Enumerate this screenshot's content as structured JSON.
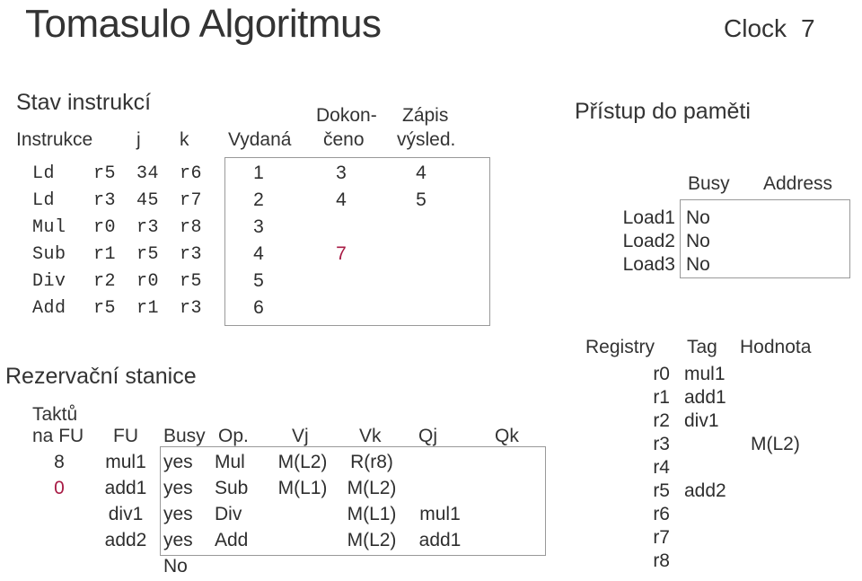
{
  "slide": {
    "title": "Tomasulo Algoritmus",
    "clock_label": "Clock",
    "clock_value": "7",
    "accent_color": "#a81b45",
    "text_color": "#2e2e2e"
  },
  "instruction_status": {
    "heading": "Stav instrukcí",
    "columns": {
      "instruction": "Instrukce",
      "j": "j",
      "k": "k",
      "issued": "Vydaná",
      "completed_line1": "Dokon-",
      "completed_line2": "čeno",
      "write_line1": "Zápis",
      "write_line2": "výsled."
    },
    "rows": [
      {
        "op": "Ld",
        "j": "r5",
        "k": "34",
        "dest": "r6",
        "issued": "1",
        "completed": "3",
        "write": "4",
        "completed_accent": false
      },
      {
        "op": "Ld",
        "j": "r3",
        "k": "45",
        "dest": "r7",
        "issued": "2",
        "completed": "4",
        "write": "5",
        "completed_accent": false
      },
      {
        "op": "Mul",
        "j": "r0",
        "k": "r3",
        "dest": "r8",
        "issued": "3",
        "completed": "",
        "write": "",
        "completed_accent": false
      },
      {
        "op": "Sub",
        "j": "r1",
        "k": "r5",
        "dest": "r3",
        "issued": "4",
        "completed": "7",
        "write": "",
        "completed_accent": true
      },
      {
        "op": "Div",
        "j": "r2",
        "k": "r0",
        "dest": "r5",
        "issued": "5",
        "completed": "",
        "write": "",
        "completed_accent": false
      },
      {
        "op": "Add",
        "j": "r5",
        "k": "r1",
        "dest": "r3",
        "issued": "6",
        "completed": "",
        "write": "",
        "completed_accent": false
      }
    ]
  },
  "reservation_stations": {
    "heading": "Rezervační stanice",
    "columns": {
      "cycles_line1": "Taktů",
      "cycles_line2": "na FU",
      "fu": "FU",
      "busy": "Busy",
      "op": "Op.",
      "vj": "Vj",
      "vk": "Vk",
      "qj": "Qj",
      "qk": "Qk"
    },
    "rows": [
      {
        "cycles": "8",
        "cycles_accent": false,
        "fu": "mul1",
        "busy": "yes",
        "op": "Mul",
        "vj": "M(L2)",
        "vk": "R(r8)",
        "qj": "",
        "qk": ""
      },
      {
        "cycles": "0",
        "cycles_accent": true,
        "fu": "add1",
        "busy": "yes",
        "op": "Sub",
        "vj": "M(L1)",
        "vk": "M(L2)",
        "qj": "",
        "qk": ""
      },
      {
        "cycles": "",
        "cycles_accent": false,
        "fu": "div1",
        "busy": "yes",
        "op": "Div",
        "vj": "",
        "vk": "M(L1)",
        "qj": "mul1",
        "qk": ""
      },
      {
        "cycles": "",
        "cycles_accent": false,
        "fu": "add2",
        "busy": "yes",
        "op": "Add",
        "vj": "",
        "vk": "M(L2)",
        "qj": "add1",
        "qk": ""
      },
      {
        "cycles": "",
        "cycles_accent": false,
        "fu": "",
        "busy": "No",
        "op": "",
        "vj": "",
        "vk": "",
        "qj": "",
        "qk": ""
      }
    ]
  },
  "memory_access": {
    "heading": "Přístup do paměti",
    "columns": {
      "busy": "Busy",
      "address": "Address"
    },
    "rows": [
      {
        "name": "Load1",
        "busy": "No",
        "address": ""
      },
      {
        "name": "Load2",
        "busy": "No",
        "address": ""
      },
      {
        "name": "Load3",
        "busy": "No",
        "address": ""
      }
    ]
  },
  "registers": {
    "columns": {
      "register": "Registry",
      "tag": "Tag",
      "value": "Hodnota"
    },
    "rows": [
      {
        "reg": "r0",
        "tag": "mul1",
        "value": ""
      },
      {
        "reg": "r1",
        "tag": "add1",
        "value": ""
      },
      {
        "reg": "r2",
        "tag": "div1",
        "value": ""
      },
      {
        "reg": "r3",
        "tag": "",
        "value": "M(L2)"
      },
      {
        "reg": "r4",
        "tag": "",
        "value": ""
      },
      {
        "reg": "r5",
        "tag": "add2",
        "value": ""
      },
      {
        "reg": "r6",
        "tag": "",
        "value": ""
      },
      {
        "reg": "r7",
        "tag": "",
        "value": ""
      },
      {
        "reg": "r8",
        "tag": "",
        "value": ""
      }
    ]
  }
}
